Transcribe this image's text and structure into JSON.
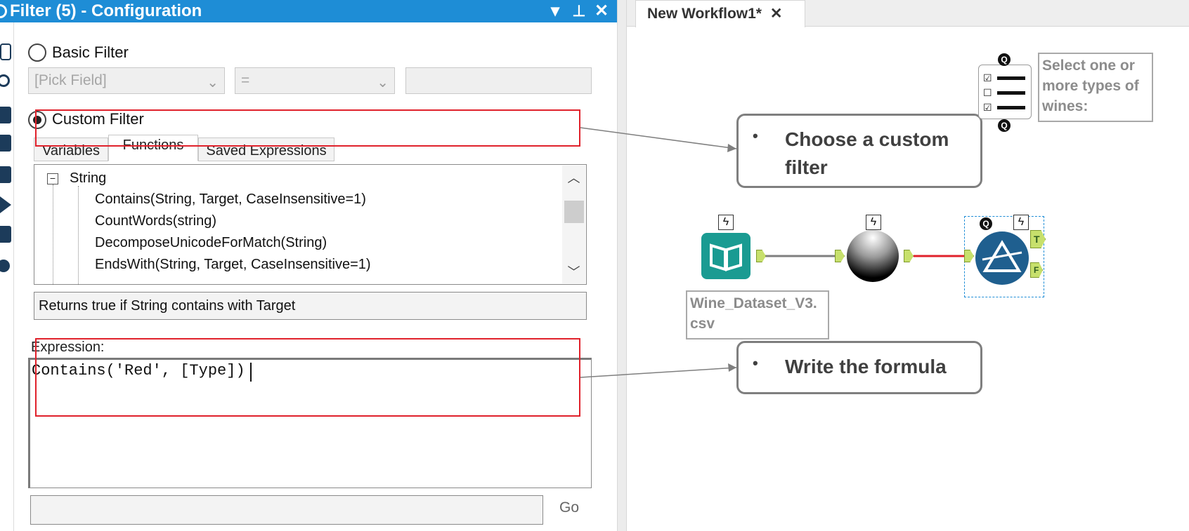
{
  "config_panel": {
    "title": "Filter (5) - Configuration",
    "title_buttons": {
      "dropdown": "▾",
      "pin": "⊥",
      "close": "✕"
    },
    "basic_filter": {
      "label": "Basic Filter",
      "field_placeholder": "[Pick Field]",
      "operator_value": "=",
      "value": ""
    },
    "custom_filter": {
      "label": "Custom Filter",
      "selected": true
    },
    "tabs": [
      "Variables",
      "Functions",
      "Saved Expressions"
    ],
    "active_tab": "Functions",
    "function_tree": {
      "category": "String",
      "items": [
        "Contains(String, Target, CaseInsensitive=1)",
        "CountWords(string)",
        "DecomposeUnicodeForMatch(String)",
        "EndsWith(String, Target, CaseInsensitive=1)"
      ]
    },
    "description": "Returns true if String contains with Target",
    "expression_label": "Expression:",
    "expression": "Contains('Red', [Type])",
    "go_label": "Go"
  },
  "workflow": {
    "tab_label": "New Workflow1*",
    "tab_close": "✕",
    "check_box_note": "Select one or more types of wines:",
    "input_label": "Wine_Dataset_V3.\ncsv",
    "filter_outputs": {
      "true": "T",
      "false": "F"
    },
    "q_badge": "Q"
  },
  "callouts": {
    "custom_filter": "Choose a custom filter",
    "formula": "Write the formula",
    "bullet": "•"
  },
  "colors": {
    "title_bar": "#1e8dd6",
    "highlight_box": "#e0212b",
    "connection_active": "#e0212b",
    "input_tool": "#1a9b92",
    "filter_tool": "#1f5f8f",
    "anchor": "#c7e06c"
  },
  "icons": {
    "tree_collapse": "minus-box-icon",
    "dropdown": "chevron-down-icon",
    "scroll_up": "chevron-up-icon",
    "scroll_down": "chevron-down-icon",
    "input_tool": "book-icon",
    "formula_tool": "sphere-icon",
    "filter_tool": "filter-triangle-icon",
    "check_box_tool": "checklist-icon"
  }
}
